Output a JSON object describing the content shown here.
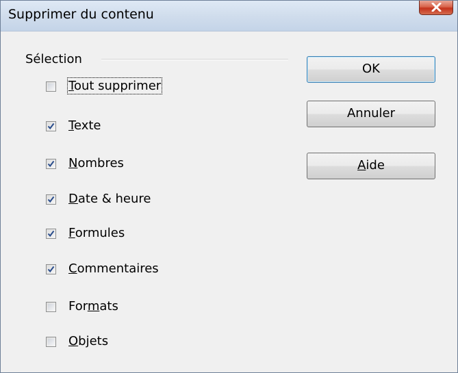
{
  "window": {
    "title": "Supprimer du contenu"
  },
  "selection": {
    "label": "Sélection",
    "options": [
      {
        "id": "tout",
        "pre": "",
        "u": "T",
        "post": "out supprimer",
        "checked": false
      },
      {
        "id": "texte",
        "pre": "",
        "u": "T",
        "post": "exte",
        "checked": true
      },
      {
        "id": "nombres",
        "pre": "",
        "u": "N",
        "post": "ombres",
        "checked": true
      },
      {
        "id": "date",
        "pre": "",
        "u": "D",
        "post": "ate & heure",
        "checked": true
      },
      {
        "id": "formules",
        "pre": "",
        "u": "F",
        "post": "ormules",
        "checked": true
      },
      {
        "id": "commentaires",
        "pre": "",
        "u": "C",
        "post": "ommentaires",
        "checked": true
      },
      {
        "id": "formats",
        "pre": "For",
        "u": "m",
        "post": "ats",
        "checked": false
      },
      {
        "id": "objets",
        "pre": "",
        "u": "O",
        "post": "bjets",
        "checked": false
      }
    ]
  },
  "buttons": {
    "ok": "OK",
    "cancel": "Annuler",
    "help_u": "A",
    "help_rest": "ide"
  }
}
